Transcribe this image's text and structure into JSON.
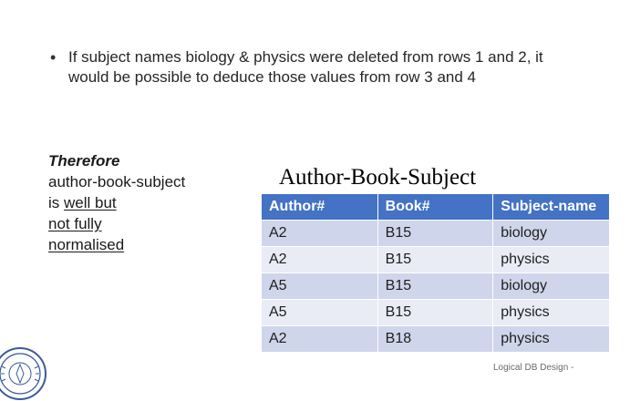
{
  "bullet": {
    "text_line1": "If subject names biology & physics were deleted from rows 1 and 2, it",
    "text_line2": "would be possible to deduce those values from row 3 and 4"
  },
  "left_note": {
    "therefore": "Therefore",
    "line1": "author-book-subject",
    "line2_prefix": "is ",
    "line2_underlined": "well but ",
    "line3_underlined": "not fully ",
    "line4_underlined": "normalised"
  },
  "table": {
    "title": "Author-Book-Subject",
    "headers": [
      "Author#",
      "Book#",
      "Subject-name"
    ],
    "rows": [
      [
        "A2",
        "B15",
        "biology"
      ],
      [
        "A2",
        "B15",
        "physics"
      ],
      [
        "A5",
        "B15",
        "biology"
      ],
      [
        "A5",
        "B15",
        "physics"
      ],
      [
        "A2",
        "B18",
        "physics"
      ]
    ]
  },
  "footer": {
    "text": "Logical DB Design -"
  },
  "colors": {
    "header_bg": "#4472c4",
    "row_odd_bg": "#cfd5ea",
    "row_even_bg": "#e9ebf5",
    "seal_color": "#3a5a9b"
  },
  "icons": {
    "seal": "university-seal-icon"
  }
}
